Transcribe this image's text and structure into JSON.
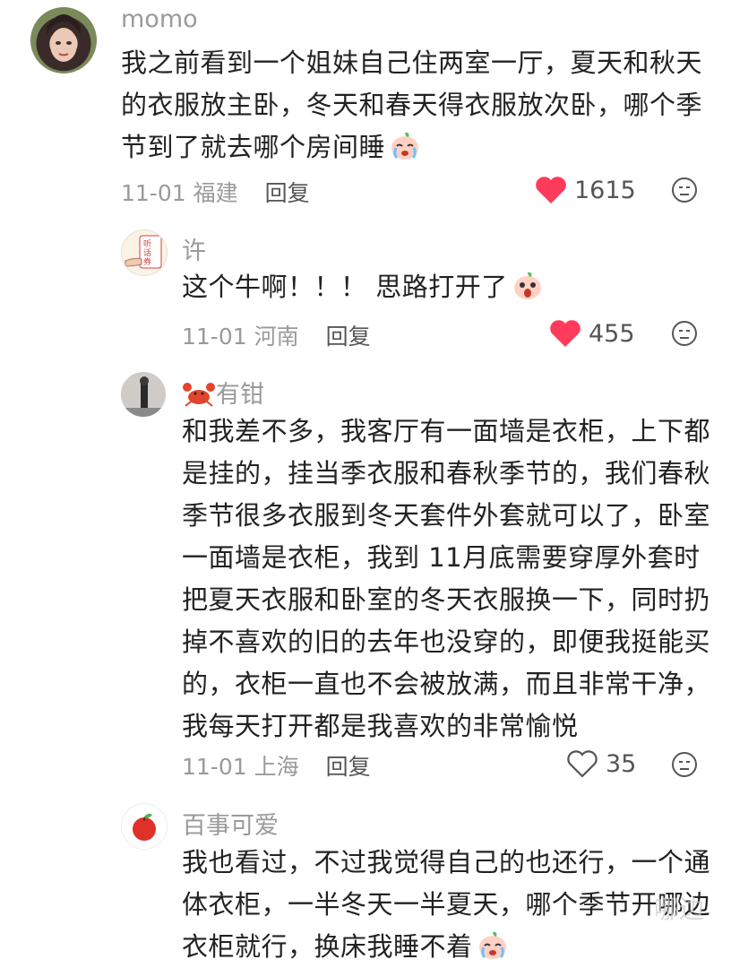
{
  "colors": {
    "like_active": "#ff3b5c",
    "meta": "#9a9a9a",
    "text": "#222222"
  },
  "comments": [
    {
      "username": "momo",
      "lines": [
        "我之前看到一个姐妹自己住两室一厅，夏天和秋天",
        "的衣服放主卧，冬天和春天得衣服放次卧，哪个季",
        "节到了就去哪个房间睡"
      ],
      "emoji": "crying-peach-emoji",
      "date": "11-01",
      "location": "福建",
      "reply_label": "回复",
      "likes": "1615",
      "liked": true
    },
    {
      "username": "许",
      "lines": [
        "这个牛啊！！！ 思路打开了"
      ],
      "emoji": "surprised-peach-emoji",
      "date": "11-01",
      "location": "河南",
      "reply_label": "回复",
      "likes": "455",
      "liked": true
    },
    {
      "username_emoji": "crab-emoji",
      "username": "有钳",
      "lines": [
        "和我差不多，我客厅有一面墙是衣柜，上下都",
        "是挂的，挂当季衣服和春秋季节的，我们春秋",
        "季节很多衣服到冬天套件外套就可以了，卧室",
        "一面墙是衣柜，我到 11月底需要穿厚外套时",
        "把夏天衣服和卧室的冬天衣服换一下，同时扔",
        "掉不喜欢的旧的去年也没穿的，即便我挺能买",
        "的，衣柜一直也不会被放满，而且非常干净，",
        "我每天打开都是我喜欢的非常愉悦"
      ],
      "date": "11-01",
      "location": "上海",
      "reply_label": "回复",
      "likes": "35",
      "liked": false
    },
    {
      "username": "百事可爱",
      "lines": [
        "我也看过，不过我觉得自己的也还行，一个通",
        "体衣柜，一半冬天一半夏天，哪个季节开哪边",
        "衣柜就行，换床我睡不着"
      ],
      "emoji": "crying-peach-emoji"
    }
  ],
  "watermark": "哪边"
}
